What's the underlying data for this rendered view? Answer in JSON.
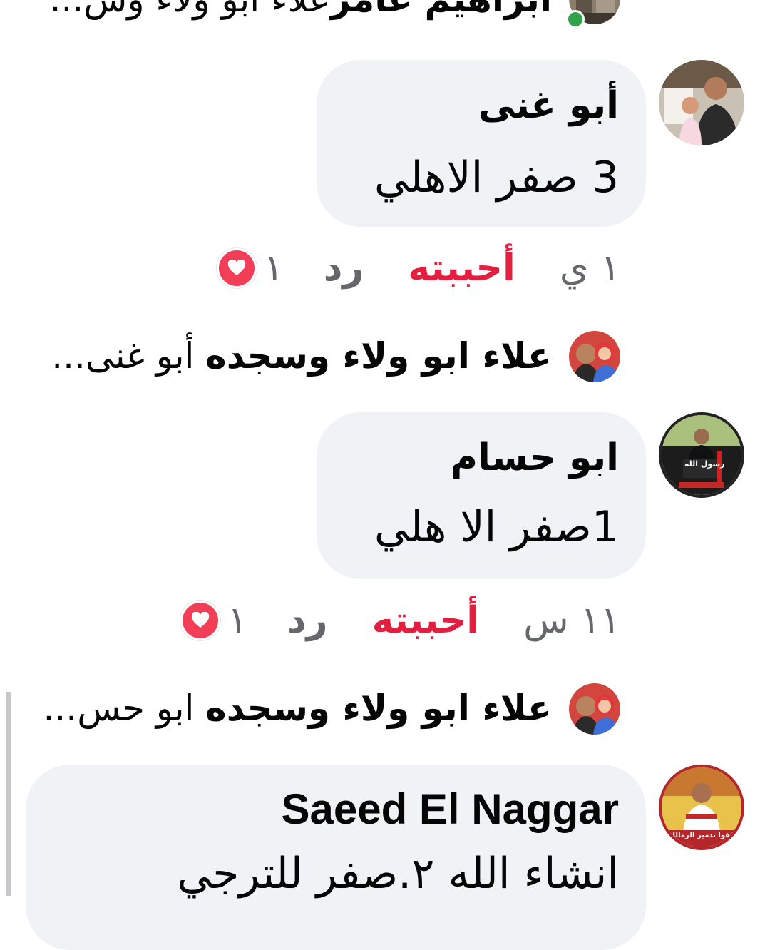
{
  "top_reply": {
    "name": "ابراهيم عامر",
    "text": "علاء ابو ولاء وس..."
  },
  "comments": [
    {
      "author": "أبو غنى",
      "text": "3 صفر الاهلي",
      "time": "١ ي",
      "like_label": "أحببته",
      "reply_label": "رد",
      "reaction_count": "١",
      "reply_preview": {
        "name": "علاء ابو ولاء وسجده",
        "text": " أبو غنى..."
      }
    },
    {
      "author": "ابو حسام",
      "text": "1صفر الا هلي",
      "time": "١١ س",
      "like_label": "أحببته",
      "reply_label": "رد",
      "reaction_count": "١",
      "reply_preview": {
        "name": "علاء ابو ولاء وسجده",
        "text": " ابو حس..."
      }
    },
    {
      "author": "Saeed El Naggar",
      "text": "انشاء الله ٢.صفر للترجي"
    }
  ],
  "avatar_captions": {
    "abu_hossam": "رسول الله",
    "saeed": "أوقفوا تدمير الزمالك"
  },
  "colors": {
    "bubble_bg": "#f0f2f5",
    "liked_red": "#e41e3f",
    "muted_gray": "#65676b",
    "heart": "#f33e58",
    "online_green": "#31a24c"
  },
  "icons": {
    "reaction": "heart-icon",
    "presence": "online-dot"
  }
}
